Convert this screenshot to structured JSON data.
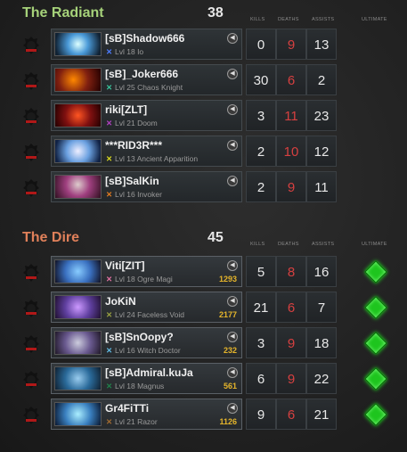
{
  "headers": {
    "kills": "KILLS",
    "deaths": "DEATHS",
    "assists": "ASSISTS",
    "ultimate": "ULTIMATE"
  },
  "radiant": {
    "name": "The Radiant",
    "score": "38",
    "color": "#a6d27a",
    "players": [
      {
        "name": "[sB]Shadow666",
        "level": "Lvl 18",
        "hero": "Io",
        "mark_color": "#4c7cff",
        "kills": "0",
        "deaths": "9",
        "assists": "13"
      },
      {
        "name": "[sB]_Joker666",
        "level": "Lvl 25",
        "hero": "Chaos Knight",
        "mark_color": "#39c29a",
        "kills": "30",
        "deaths": "6",
        "assists": "2"
      },
      {
        "name": "riki[ZLT]",
        "level": "Lvl 21",
        "hero": "Doom",
        "mark_color": "#b040c0",
        "kills": "3",
        "deaths": "11",
        "assists": "23"
      },
      {
        "name": "***RID3R***",
        "level": "Lvl 13",
        "hero": "Ancient Apparition",
        "mark_color": "#d8d820",
        "kills": "2",
        "deaths": "10",
        "assists": "12"
      },
      {
        "name": "[sB]SalKin",
        "level": "Lvl 16",
        "hero": "Invoker",
        "mark_color": "#e07a20",
        "kills": "2",
        "deaths": "9",
        "assists": "11"
      }
    ]
  },
  "dire": {
    "name": "The Dire",
    "score": "45",
    "color": "#e0805a",
    "players": [
      {
        "name": "Viti[ZIT]",
        "level": "Lvl 18",
        "hero": "Ogre Magi",
        "mark_color": "#e070a0",
        "gold": "1293",
        "kills": "5",
        "deaths": "8",
        "assists": "16"
      },
      {
        "name": "JoKiN",
        "level": "Lvl 24",
        "hero": "Faceless Void",
        "mark_color": "#98a040",
        "gold": "2177",
        "kills": "21",
        "deaths": "6",
        "assists": "7"
      },
      {
        "name": "[sB]SnOopy?",
        "level": "Lvl 16",
        "hero": "Witch Doctor",
        "mark_color": "#60b8e0",
        "gold": "232",
        "kills": "3",
        "deaths": "9",
        "assists": "18"
      },
      {
        "name": "[sB]Admiral.kuJa",
        "level": "Lvl 18",
        "hero": "Magnus",
        "mark_color": "#20804a",
        "gold": "561",
        "kills": "6",
        "deaths": "9",
        "assists": "22"
      },
      {
        "name": "Gr4FiTTi",
        "level": "Lvl 21",
        "hero": "Razor",
        "mark_color": "#a06a30",
        "gold": "1126",
        "kills": "9",
        "deaths": "6",
        "assists": "21"
      }
    ]
  },
  "icons": {
    "team_logo": "skull-logo-icon",
    "voice": "speaker-icon",
    "ultimate_ready": "green-gem-icon"
  }
}
